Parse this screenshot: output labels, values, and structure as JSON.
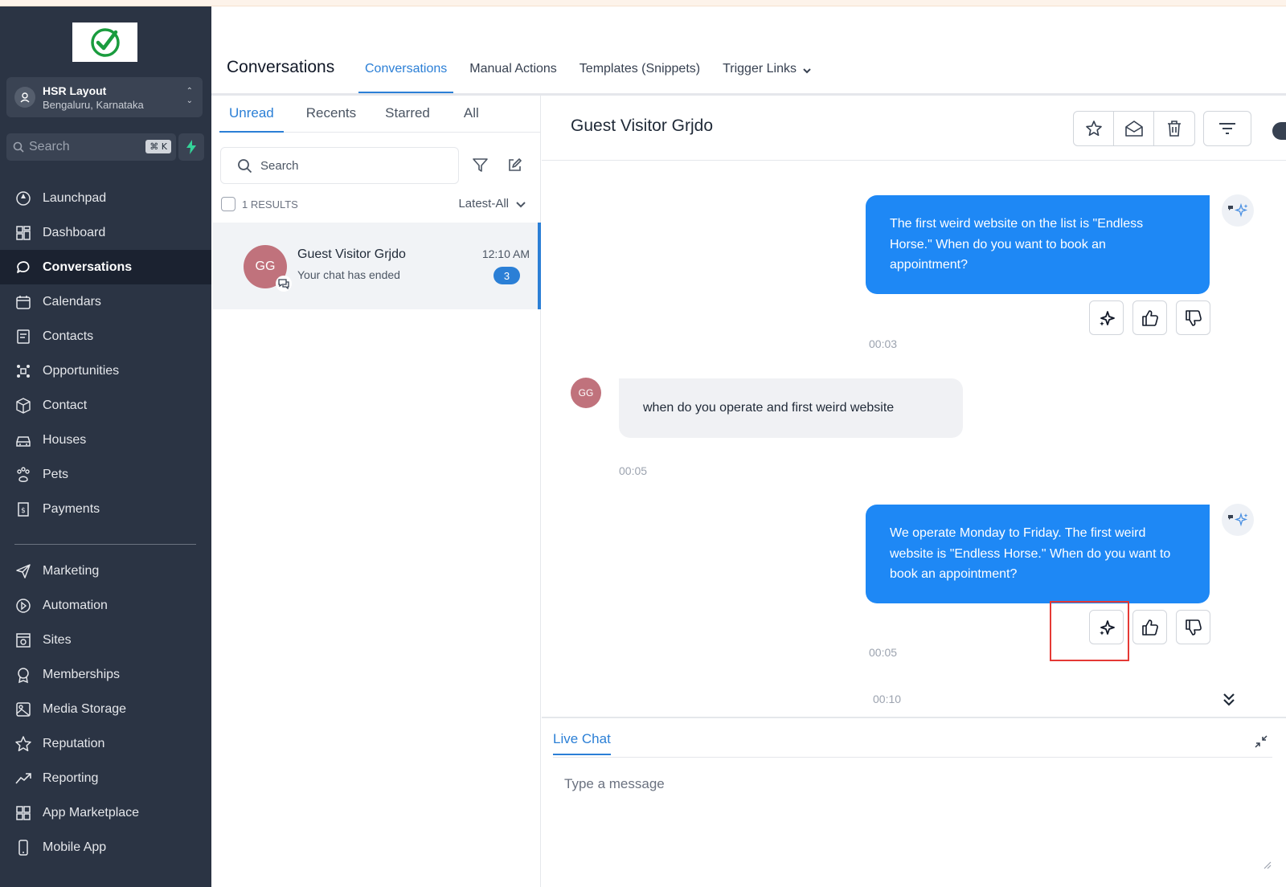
{
  "sidebar": {
    "location": {
      "name": "HSR Layout",
      "sub": "Bengaluru, Karnataka"
    },
    "search": {
      "placeholder": "Search",
      "shortcut": "⌘ K"
    },
    "items": [
      {
        "label": "Launchpad",
        "icon": "launchpad-icon"
      },
      {
        "label": "Dashboard",
        "icon": "dashboard-icon"
      },
      {
        "label": "Conversations",
        "icon": "chat-bubble-icon",
        "active": true
      },
      {
        "label": "Calendars",
        "icon": "calendar-icon"
      },
      {
        "label": "Contacts",
        "icon": "contacts-icon"
      },
      {
        "label": "Opportunities",
        "icon": "opportunities-icon"
      },
      {
        "label": "Contact",
        "icon": "box-icon"
      },
      {
        "label": "Houses",
        "icon": "car-icon"
      },
      {
        "label": "Pets",
        "icon": "paw-icon"
      },
      {
        "label": "Payments",
        "icon": "payments-icon"
      }
    ],
    "items2": [
      {
        "label": "Marketing",
        "icon": "send-icon"
      },
      {
        "label": "Automation",
        "icon": "automation-icon"
      },
      {
        "label": "Sites",
        "icon": "sites-icon"
      },
      {
        "label": "Memberships",
        "icon": "badge-icon"
      },
      {
        "label": "Media Storage",
        "icon": "image-icon"
      },
      {
        "label": "Reputation",
        "icon": "star-icon"
      },
      {
        "label": "Reporting",
        "icon": "trend-icon"
      },
      {
        "label": "App Marketplace",
        "icon": "grid-icon"
      },
      {
        "label": "Mobile App",
        "icon": "phone-icon"
      }
    ]
  },
  "header": {
    "title": "Conversations",
    "tabs": [
      {
        "label": "Conversations",
        "active": true
      },
      {
        "label": "Manual Actions"
      },
      {
        "label": "Templates (Snippets)"
      },
      {
        "label": "Trigger Links"
      }
    ]
  },
  "list": {
    "tabs": [
      "Unread",
      "Recents",
      "Starred",
      "All"
    ],
    "search_placeholder": "Search",
    "results": "1 RESULTS",
    "sort": "Latest-All",
    "conversations": [
      {
        "initials": "GG",
        "name": "Guest Visitor Grjdo",
        "preview": "Your chat has ended",
        "time": "12:10 AM",
        "count": "3"
      }
    ]
  },
  "chat": {
    "title": "Guest Visitor Grjdo",
    "messages": [
      {
        "dir": "out",
        "text": "The first weird website on the list is \"Endless Horse.\" When do you want to book an appointment?",
        "time": "00:03"
      },
      {
        "dir": "in",
        "initials": "GG",
        "text": "when do you operate and first weird website",
        "time": "00:05"
      },
      {
        "dir": "out",
        "text": "We operate Monday to Friday. The first weird website is \"Endless Horse.\" When do you want to book an appointment?",
        "time": "00:05"
      }
    ],
    "last_time": "00:10",
    "composer": {
      "tab": "Live Chat",
      "placeholder": "Type a message"
    }
  },
  "colors": {
    "sidebar_bg": "#2b3444",
    "accent": "#2b7fd6",
    "bubble_out": "#1e88f5",
    "avatar": "#c0727c",
    "highlight": "#e53935"
  }
}
